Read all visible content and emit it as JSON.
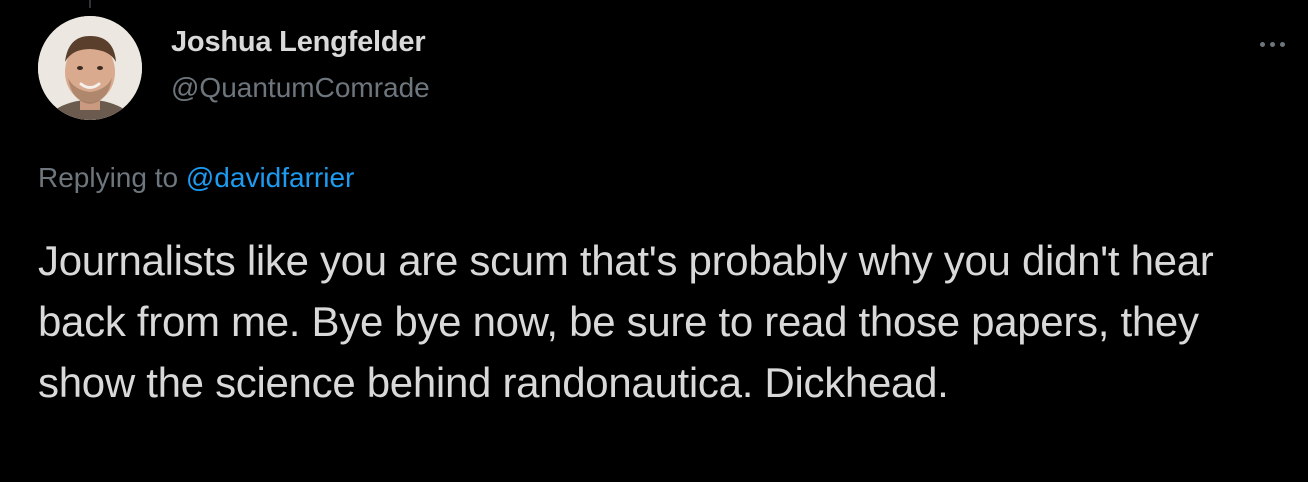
{
  "author": {
    "display_name": "Joshua Lengfelder",
    "handle": "@QuantumComrade"
  },
  "reply": {
    "prefix": "Replying to",
    "mention": "@davidfarrier"
  },
  "tweet": {
    "text": "Journalists like you are scum that's probably why you didn't hear back from me. Bye bye now, be sure to read those papers, they show the science behind randonautica. Dickhead."
  },
  "icons": {
    "more": "more-horizontal-icon"
  },
  "colors": {
    "background": "#000000",
    "text_primary": "#d9d9d9",
    "text_secondary": "#6e767d",
    "link": "#1d9bf0"
  }
}
